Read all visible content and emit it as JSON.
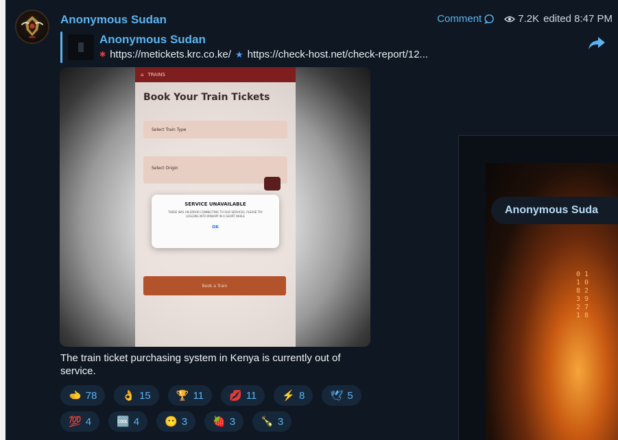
{
  "post": {
    "channel_name": "Anonymous Sudan",
    "comment_label": "Comment",
    "views": "7.2K",
    "edited": "edited 8:47 PM",
    "reply": {
      "name": "Anonymous Sudan",
      "link1": "https://metickets.krc.co.ke/",
      "link2": "https://check-host.net/check-report/12..."
    },
    "photo": {
      "app_bar": "TRAINS",
      "title": "Book Your Train Tickets",
      "field1": "Select Train Type",
      "field2": "Select Origin",
      "button": "Book a Train",
      "dialog_title": "SERVICE UNAVAILABLE",
      "dialog_message": "THERE WAS AN ERROR CONNECTING TO OUR SERVICES. PLEASE TRY LOGGING INTO MINIAPP IN A SHORT WHILE",
      "dialog_ok": "OK"
    },
    "caption": "The train ticket purchasing system in Kenya is currently out of service.",
    "reactions_row1": [
      {
        "emoji": "🫲",
        "count": "78"
      },
      {
        "emoji": "👌",
        "count": "15"
      },
      {
        "emoji": "🏆",
        "count": "11"
      },
      {
        "emoji": "💋",
        "count": "11"
      },
      {
        "emoji": "⚡",
        "count": "8"
      },
      {
        "emoji": "🕊",
        "count": "5"
      }
    ],
    "reactions_row2": [
      {
        "emoji": "💯",
        "count": "4"
      },
      {
        "emoji": "🆒",
        "count": "4"
      },
      {
        "emoji": "😶",
        "count": "3"
      },
      {
        "emoji": "🍓",
        "count": "3"
      },
      {
        "emoji": "🍾",
        "count": "3"
      }
    ]
  },
  "side_post": {
    "label": "Anonymous Suda"
  },
  "colors": {
    "accent": "#5cb3f0",
    "background": "#0f1822",
    "reaction_bg": "#16273a"
  }
}
